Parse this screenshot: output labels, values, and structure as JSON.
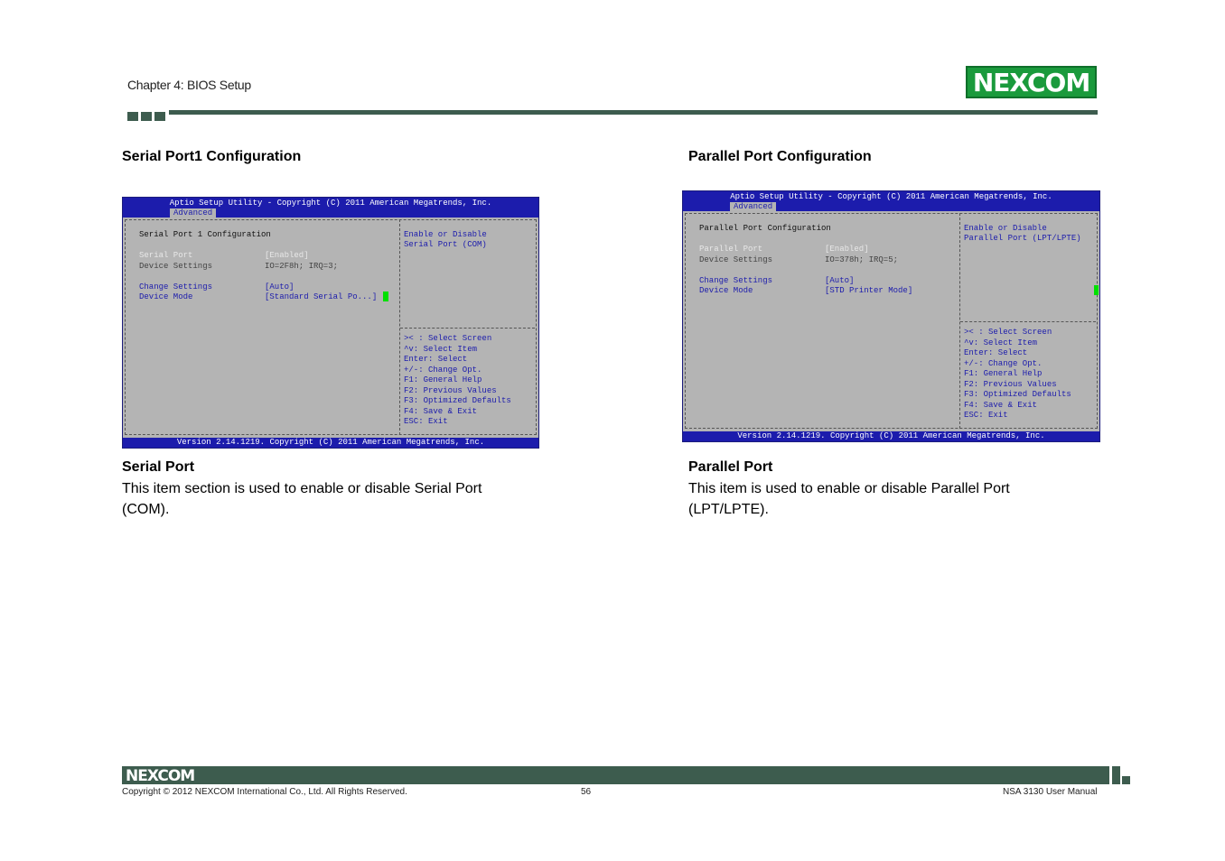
{
  "header": {
    "chapter": "Chapter 4: BIOS Setup",
    "logo": "NEXCOM"
  },
  "left": {
    "section_title": "Serial Port1 Configuration",
    "bios": {
      "title": "Aptio Setup Utility - Copyright (C) 2011 American Megatrends, Inc.",
      "tab": "Advanced",
      "heading": "Serial Port 1 Configuration",
      "items": [
        {
          "label": "Serial Port",
          "value": "[Enabled]"
        },
        {
          "label": "Device Settings",
          "value": "IO=2F8h; IRQ=3;"
        },
        {
          "label": "Change Settings",
          "value": "[Auto]"
        },
        {
          "label": "Device Mode",
          "value": "[Standard Serial Po...]"
        }
      ],
      "help": [
        "Enable or Disable",
        "Serial Port (COM)"
      ],
      "keys": [
        ">< : Select Screen",
        "^v: Select Item",
        "Enter: Select",
        "+/-: Change Opt.",
        "F1: General Help",
        "F2: Previous Values",
        "F3: Optimized Defaults",
        "F4: Save & Exit",
        "ESC: Exit"
      ],
      "footer": "Version 2.14.1219. Copyright (C) 2011 American Megatrends, Inc."
    },
    "body_title": "Serial Port",
    "body_text": "This item section is used to enable or disable Serial Port (COM)."
  },
  "right": {
    "section_title": "Parallel Port Configuration",
    "bios": {
      "title": "Aptio Setup Utility - Copyright (C) 2011 American Megatrends, Inc.",
      "tab": "Advanced",
      "heading": "Parallel Port Configuration",
      "items": [
        {
          "label": "Parallel Port",
          "value": "[Enabled]"
        },
        {
          "label": "Device Settings",
          "value": "IO=378h; IRQ=5;"
        },
        {
          "label": "Change Settings",
          "value": "[Auto]"
        },
        {
          "label": "Device Mode",
          "value": "[STD Printer Mode]"
        }
      ],
      "help": [
        "Enable or Disable",
        "Parallel Port (LPT/LPTE)"
      ],
      "keys": [
        ">< : Select Screen",
        "^v: Select Item",
        "Enter: Select",
        "+/-: Change Opt.",
        "F1: General Help",
        "F2: Previous Values",
        "F3: Optimized Defaults",
        "F4: Save & Exit",
        "ESC: Exit"
      ],
      "footer": "Version 2.14.1219. Copyright (C) 2011 American Megatrends, Inc."
    },
    "body_title": "Parallel Port",
    "body_text": "This item is used to enable or disable Parallel Port (LPT/LPTE)."
  },
  "footer": {
    "logo": "NEXCOM",
    "copyright": "Copyright © 2012 NEXCOM International Co., Ltd. All Rights Reserved.",
    "page": "56",
    "manual": "NSA 3130 User Manual"
  },
  "colors": {
    "brand_green": "#1a9a3c",
    "bar_green": "#3d5c4e",
    "bios_blue": "#1c1cac",
    "bios_gray": "#b4b4b4",
    "cursor_green": "#00e000"
  }
}
